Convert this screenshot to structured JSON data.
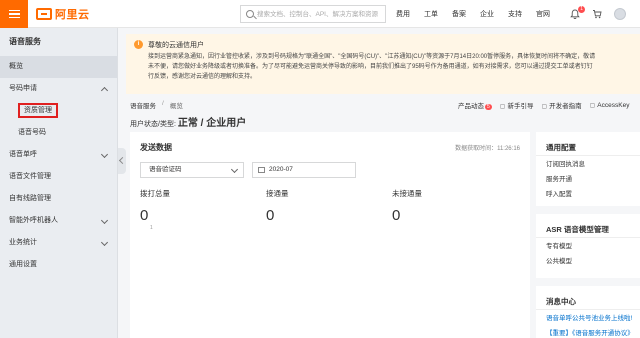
{
  "topbar": {
    "logo_text": "阿里云",
    "search_placeholder": "搜索文档、控制台、API、解决方案和资源",
    "nav": [
      "费用",
      "工单",
      "备案",
      "企业",
      "支持",
      "官网"
    ],
    "notification_count": "1",
    "accent_color": "#ff6a00"
  },
  "sidebar": {
    "title": "语音服务",
    "items": [
      {
        "label": "概览",
        "active": true
      },
      {
        "label": "号码申请",
        "expanded": true
      },
      {
        "label": "资质管理",
        "sub": true,
        "highlighted": true
      },
      {
        "label": "语音号码",
        "sub": true
      },
      {
        "label": "语音单呼"
      },
      {
        "label": "语音文件管理"
      },
      {
        "label": "自有线路管理"
      },
      {
        "label": "智能外呼机器人"
      },
      {
        "label": "业务统计"
      },
      {
        "label": "通用设置"
      }
    ]
  },
  "notice": {
    "title": "尊敬的云通信用户",
    "lines": [
      "接到运营商紧急通知，因行业管控收紧，涉及到号码规格为\"联通全国\"、\"全国码号(CU)\"、\"江苏通知(CU)\"等资源于7月14日20:00暂停服务，具体恢复时间将不确定，敬请",
      "未不便，请您做好业务降级或者切换准备。为了尽可能避免运营商关停导致的影响，目前我们推出了95码号作为备用通道，如有对接需求，您可以通过提交工单或者钉钉",
      "行反馈，感谢您对云通信的理解和支持。"
    ]
  },
  "breadcrumb": {
    "root": "语音服务",
    "sep": "/",
    "current": "概览"
  },
  "user_status": {
    "label": "用户状态/类型:",
    "value": "正常 / 企业用户"
  },
  "header_links": {
    "updates": "产品动态",
    "updates_badge": "5",
    "guide": "新手引导",
    "dev_guide": "开发者指南",
    "access_key": "AccessKey"
  },
  "send_data": {
    "title": "发送数据",
    "timestamp": "数据获取时间：11:26:16",
    "type_select": "语音验证码",
    "month_select": "2020-07",
    "stats": [
      {
        "label": "拨打总量",
        "value": "0"
      },
      {
        "label": "接通量",
        "value": "0"
      },
      {
        "label": "未接通量",
        "value": "0"
      }
    ],
    "axis_tick": "1"
  },
  "general_config": {
    "title": "通用配置",
    "items": [
      "订阅回执消息",
      "服务开通",
      "呼入配置"
    ]
  },
  "asr_config": {
    "title": "ASR 语音模型管理",
    "items": [
      "专有模型",
      "公共模型"
    ]
  },
  "message_center": {
    "title": "消息中心",
    "items": [
      "语音单呼公共号池业务上线啦!",
      "【重要】《语音服务开通协议》"
    ]
  }
}
